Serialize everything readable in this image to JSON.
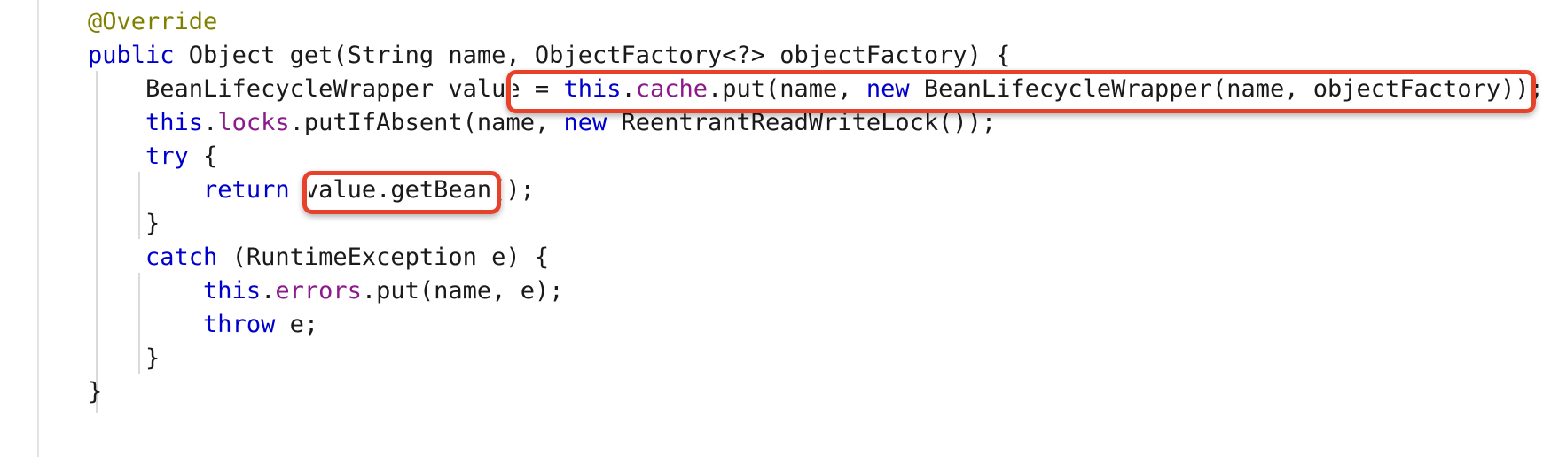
{
  "editor": {
    "language": "java",
    "background_color": "#ffffff",
    "text_color": "#1a1a1a",
    "keyword_color": "#0000cd",
    "annotation_color": "#808000",
    "field_color": "#8b1a8b",
    "guide_color": "#dadada",
    "border_color": "#e2e2e2"
  },
  "highlights": [
    {
      "name": "cache-put-highlight",
      "color": "#e8412a",
      "text": "this.cache.put(name, new BeanLifecycleWrapper(name, objectFactory));",
      "line": 3
    },
    {
      "name": "get-bean-highlight",
      "color": "#e8412a",
      "text": "value.getBean();",
      "line": 5
    }
  ],
  "code_lines": [
    {
      "number": 1,
      "tokens": [
        {
          "t": "@Override",
          "c": "anno"
        }
      ]
    },
    {
      "number": 2,
      "tokens": [
        {
          "t": "public",
          "c": "kw"
        },
        {
          "t": " Object get(String name, ObjectFactory<?> objectFactory) {",
          "c": "plain"
        }
      ]
    },
    {
      "number": 3,
      "tokens": [
        {
          "t": "    BeanLifecycleWrapper value = ",
          "c": "plain"
        },
        {
          "t": "this",
          "c": "kw"
        },
        {
          "t": ".",
          "c": "plain"
        },
        {
          "t": "cache",
          "c": "field"
        },
        {
          "t": ".put(name, ",
          "c": "plain"
        },
        {
          "t": "new",
          "c": "kw"
        },
        {
          "t": " BeanLifecycleWrapper(name, objectFactory));",
          "c": "plain"
        }
      ]
    },
    {
      "number": 4,
      "tokens": [
        {
          "t": "    ",
          "c": "plain"
        },
        {
          "t": "this",
          "c": "kw"
        },
        {
          "t": ".",
          "c": "plain"
        },
        {
          "t": "locks",
          "c": "field"
        },
        {
          "t": ".putIfAbsent(name, ",
          "c": "plain"
        },
        {
          "t": "new",
          "c": "kw"
        },
        {
          "t": " ReentrantReadWriteLock());",
          "c": "plain"
        }
      ]
    },
    {
      "number": 5,
      "tokens": [
        {
          "t": "    ",
          "c": "plain"
        },
        {
          "t": "try",
          "c": "kw"
        },
        {
          "t": " {",
          "c": "plain"
        }
      ]
    },
    {
      "number": 6,
      "tokens": [
        {
          "t": "        ",
          "c": "plain"
        },
        {
          "t": "return",
          "c": "kw"
        },
        {
          "t": " value.getBean();",
          "c": "plain"
        }
      ]
    },
    {
      "number": 7,
      "tokens": [
        {
          "t": "    }",
          "c": "plain"
        }
      ]
    },
    {
      "number": 8,
      "tokens": [
        {
          "t": "    ",
          "c": "plain"
        },
        {
          "t": "catch",
          "c": "kw"
        },
        {
          "t": " (RuntimeException e) {",
          "c": "plain"
        }
      ]
    },
    {
      "number": 9,
      "tokens": [
        {
          "t": "        ",
          "c": "plain"
        },
        {
          "t": "this",
          "c": "kw"
        },
        {
          "t": ".",
          "c": "plain"
        },
        {
          "t": "errors",
          "c": "field"
        },
        {
          "t": ".put(name, e);",
          "c": "plain"
        }
      ]
    },
    {
      "number": 10,
      "tokens": [
        {
          "t": "        ",
          "c": "plain"
        },
        {
          "t": "throw",
          "c": "kw"
        },
        {
          "t": " e;",
          "c": "plain"
        }
      ]
    },
    {
      "number": 11,
      "tokens": [
        {
          "t": "    }",
          "c": "plain"
        }
      ]
    },
    {
      "number": 12,
      "tokens": [
        {
          "t": "}",
          "c": "plain"
        }
      ]
    }
  ]
}
